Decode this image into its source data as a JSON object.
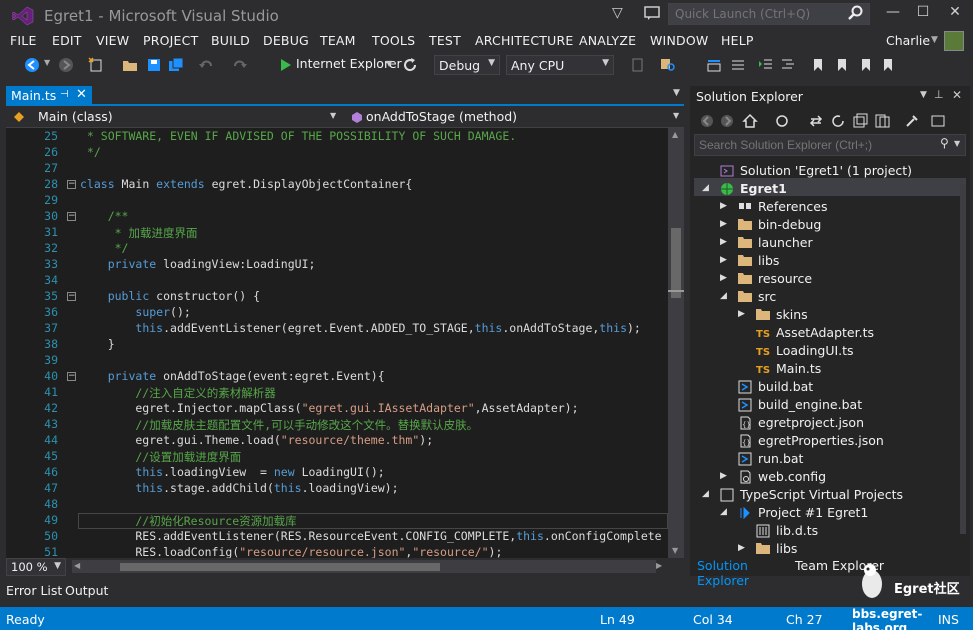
{
  "window": {
    "title": "Egret1 - Microsoft Visual Studio",
    "quick_launch_placeholder": "Quick Launch (Ctrl+Q)",
    "user": "Charlie"
  },
  "menu": [
    "FILE",
    "EDIT",
    "VIEW",
    "PROJECT",
    "BUILD",
    "DEBUG",
    "TEAM",
    "TOOLS",
    "TEST",
    "ARCHITECTURE",
    "ANALYZE",
    "WINDOW",
    "HELP"
  ],
  "toolbar": {
    "browser": "Internet Explorer",
    "config": "Debug",
    "platform": "Any CPU"
  },
  "editor": {
    "tab": "Main.ts",
    "nav_class": "Main (class)",
    "nav_method": "onAddToStage (method)",
    "zoom": "100 %",
    "lines": [
      {
        "n": "25",
        "t": " * SOFTWARE, EVEN IF ADVISED OF THE POSSIBILITY OF SUCH DAMAGE."
      },
      {
        "n": "26",
        "t": " */"
      },
      {
        "n": "27",
        "t": ""
      },
      {
        "n": "28",
        "t": "class Main extends egret.DisplayObjectContainer{"
      },
      {
        "n": "29",
        "t": ""
      },
      {
        "n": "30",
        "t": "    /**"
      },
      {
        "n": "31",
        "t": "     * 加载进度界面"
      },
      {
        "n": "32",
        "t": "     */"
      },
      {
        "n": "33",
        "t": "    private loadingView:LoadingUI;"
      },
      {
        "n": "34",
        "t": ""
      },
      {
        "n": "35",
        "t": "    public constructor() {"
      },
      {
        "n": "36",
        "t": "        super();"
      },
      {
        "n": "37",
        "t": "        this.addEventListener(egret.Event.ADDED_TO_STAGE,this.onAddToStage,this);"
      },
      {
        "n": "38",
        "t": "    }"
      },
      {
        "n": "39",
        "t": ""
      },
      {
        "n": "40",
        "t": "    private onAddToStage(event:egret.Event){"
      },
      {
        "n": "41",
        "t": "        //注入自定义的素材解析器"
      },
      {
        "n": "42",
        "t": "        egret.Injector.mapClass(\"egret.gui.IAssetAdapter\",AssetAdapter);"
      },
      {
        "n": "43",
        "t": "        //加载皮肤主题配置文件,可以手动修改这个文件。替换默认皮肤。"
      },
      {
        "n": "44",
        "t": "        egret.gui.Theme.load(\"resource/theme.thm\");"
      },
      {
        "n": "45",
        "t": "        //设置加载进度界面"
      },
      {
        "n": "46",
        "t": "        this.loadingView  = new LoadingUI();"
      },
      {
        "n": "47",
        "t": "        this.stage.addChild(this.loadingView);"
      },
      {
        "n": "48",
        "t": ""
      },
      {
        "n": "49",
        "t": "        //初始化Resource资源加载库"
      },
      {
        "n": "50",
        "t": "        RES.addEventListener(RES.ResourceEvent.CONFIG_COMPLETE,this.onConfigComplete"
      },
      {
        "n": "51",
        "t": "        RES.loadConfig(\"resource/resource.json\",\"resource/\");"
      }
    ]
  },
  "bottom_tabs": [
    "Error List",
    "Output"
  ],
  "solution_explorer": {
    "title": "Solution Explorer",
    "search_placeholder": "Search Solution Explorer (Ctrl+;)",
    "tree": [
      {
        "label": "Solution 'Egret1' (1 project)",
        "depth": 0,
        "arrow": "",
        "icon": "solution"
      },
      {
        "label": "Egret1",
        "depth": 0,
        "arrow": "open",
        "icon": "web",
        "bold": true
      },
      {
        "label": "References",
        "depth": 1,
        "arrow": "closed",
        "icon": "refs"
      },
      {
        "label": "bin-debug",
        "depth": 1,
        "arrow": "closed",
        "icon": "folder"
      },
      {
        "label": "launcher",
        "depth": 1,
        "arrow": "closed",
        "icon": "folder"
      },
      {
        "label": "libs",
        "depth": 1,
        "arrow": "closed",
        "icon": "folder"
      },
      {
        "label": "resource",
        "depth": 1,
        "arrow": "closed",
        "icon": "folder"
      },
      {
        "label": "src",
        "depth": 1,
        "arrow": "open",
        "icon": "folder"
      },
      {
        "label": "skins",
        "depth": 2,
        "arrow": "closed",
        "icon": "folder"
      },
      {
        "label": "AssetAdapter.ts",
        "depth": 2,
        "arrow": "",
        "icon": "ts"
      },
      {
        "label": "LoadingUI.ts",
        "depth": 2,
        "arrow": "",
        "icon": "ts"
      },
      {
        "label": "Main.ts",
        "depth": 2,
        "arrow": "",
        "icon": "ts"
      },
      {
        "label": "build.bat",
        "depth": 1,
        "arrow": "",
        "icon": "bat"
      },
      {
        "label": "build_engine.bat",
        "depth": 1,
        "arrow": "",
        "icon": "bat"
      },
      {
        "label": "egretproject.json",
        "depth": 1,
        "arrow": "",
        "icon": "json"
      },
      {
        "label": "egretProperties.json",
        "depth": 1,
        "arrow": "",
        "icon": "json"
      },
      {
        "label": "run.bat",
        "depth": 1,
        "arrow": "",
        "icon": "bat"
      },
      {
        "label": "web.config",
        "depth": 1,
        "arrow": "closed",
        "icon": "config"
      },
      {
        "label": "TypeScript Virtual Projects",
        "depth": 0,
        "arrow": "open",
        "icon": "tsvp"
      },
      {
        "label": "Project #1 Egret1",
        "depth": 1,
        "arrow": "open",
        "icon": "proj"
      },
      {
        "label": "lib.d.ts",
        "depth": 2,
        "arrow": "",
        "icon": "lib"
      },
      {
        "label": "libs",
        "depth": 2,
        "arrow": "closed",
        "icon": "folder"
      }
    ],
    "tabs": [
      "Solution Explorer",
      "Team Explorer"
    ]
  },
  "status": {
    "state": "Ready",
    "ln": "Ln 49",
    "col": "Col 34",
    "ch": "Ch 27",
    "mode": "INS"
  },
  "watermark": {
    "text": "Egret社区",
    "url": "bbs.egret-labs.org"
  }
}
